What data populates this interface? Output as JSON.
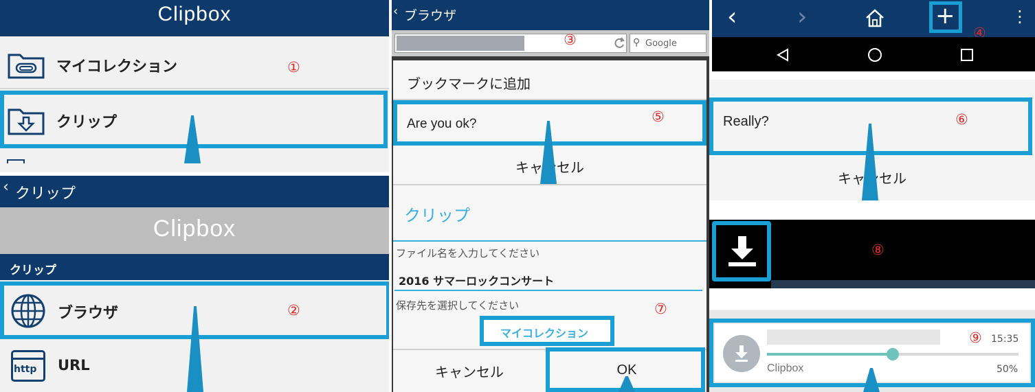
{
  "panel1": {
    "app_title": "Clipbox",
    "items": [
      {
        "label": "マイコレクション",
        "icon": "folder-paperclip-icon"
      },
      {
        "label": "クリップ",
        "icon": "folder-download-icon"
      }
    ],
    "step": "①"
  },
  "panel2": {
    "back_label": "クリップ",
    "banner": "Clipbox",
    "section_header": "クリップ",
    "items": [
      {
        "label": "ブラウザ",
        "icon": "globe-icon"
      },
      {
        "label": "URL",
        "icon": "http-icon",
        "icon_text": "http"
      }
    ],
    "step": "②"
  },
  "panel3": {
    "back_label": "ブラウザ",
    "search_placeholder": "Google",
    "step_url": "③",
    "dialog1": {
      "title": "ブックマークに追加",
      "option": "Are you ok?",
      "cancel": "キャンセル",
      "step": "⑤"
    },
    "dialog2": {
      "title": "クリップ",
      "filename_label": "ファイル名を入力してください",
      "filename_value": "2016 サマーロックコンサート",
      "dest_label": "保存先を選択してください",
      "dest_button": "マイコレクション",
      "cancel": "キャンセル",
      "ok": "OK",
      "step": "⑦"
    }
  },
  "panel4": {
    "step_plus": "④",
    "dialog": {
      "option": "Really?",
      "cancel": "キャンセル",
      "step": "⑥"
    },
    "step_download": "⑧",
    "notification": {
      "app": "Clipbox",
      "time": "15:35",
      "percent": "50%",
      "progress": 0.5,
      "step": "⑨"
    }
  },
  "colors": {
    "navy": "#0d3a6a",
    "highlight": "#1a9fd4",
    "accent_text": "#3bb0e0",
    "step_number": "#e02a2a"
  }
}
